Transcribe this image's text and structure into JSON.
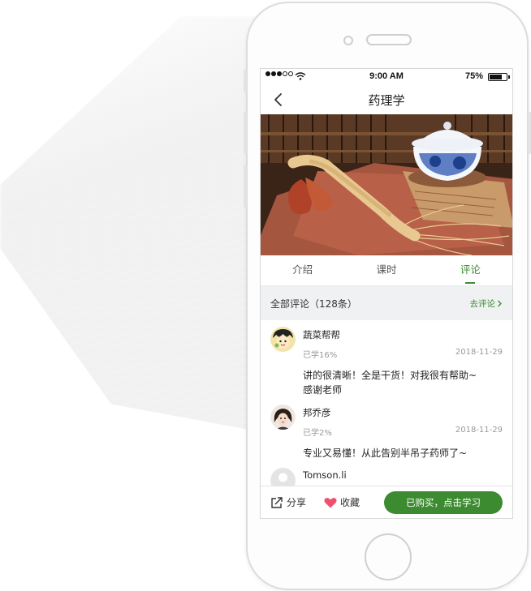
{
  "status_bar": {
    "time": "9:00 AM",
    "battery": "75%",
    "battery_level": 0.75
  },
  "nav": {
    "title": "药理学"
  },
  "hero": {
    "image": "ginseng-and-teacup-photo"
  },
  "tabs": [
    {
      "label": "介绍",
      "active": false
    },
    {
      "label": "课时",
      "active": false
    },
    {
      "label": "评论",
      "active": true
    }
  ],
  "comments_section": {
    "title": "全部评论（128条）",
    "action_label": "去评论"
  },
  "comments": [
    {
      "name": "蔬菜帮帮",
      "progress": "已学16%",
      "date": "2018-11-29",
      "body": [
        "讲的很清晰！全是干货！对我很有帮助~",
        "感谢老师"
      ]
    },
    {
      "name": "邦乔彦",
      "progress": "已学2%",
      "date": "2018-11-29",
      "body": [
        "专业又易懂！从此告别半吊子药师了~"
      ]
    },
    {
      "name": "Tomson.li",
      "progress": "",
      "date": "",
      "body": []
    }
  ],
  "bottom_bar": {
    "share_label": "分享",
    "favorite_label": "收藏",
    "buy_label": "已购买，点击学习"
  },
  "colors": {
    "accent": "#3d8b31",
    "section_bg": "#eff1f3",
    "favorite": "#f0506e"
  }
}
